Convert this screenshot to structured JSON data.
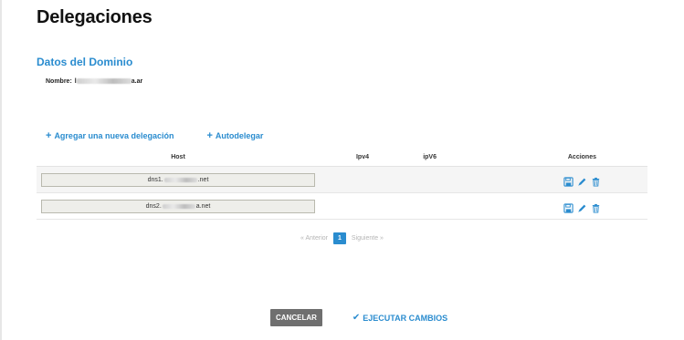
{
  "page": {
    "title": "Delegaciones"
  },
  "domain_section": {
    "title": "Datos del Dominio",
    "name_label": "Nombre:",
    "name_value_visible_suffix": "a.ar",
    "name_value_visible_prefix": "l"
  },
  "actions": {
    "add_delegation": "Agregar una nueva delegación",
    "autodelegate": "Autodelegar"
  },
  "table": {
    "headers": {
      "host": "Host",
      "ipv4": "Ipv4",
      "ipv6": "ipV6",
      "actions": "Acciones"
    },
    "rows": [
      {
        "host_prefix": "dns1.",
        "host_suffix": ".net"
      },
      {
        "host_prefix": "dns2.",
        "host_suffix": "a.net"
      }
    ]
  },
  "pagination": {
    "prev": "« Anterior",
    "current": "1",
    "next": "Siguiente »"
  },
  "footer": {
    "cancel": "CANCELAR",
    "execute": "EJECUTAR CAMBIOS"
  },
  "colors": {
    "accent": "#2a8ccf",
    "cancel_bg": "#6f6f6f"
  },
  "icons": {
    "save": "save-icon",
    "edit": "pencil-icon",
    "delete": "trash-icon",
    "add": "plus-icon",
    "confirm": "check-icon"
  }
}
